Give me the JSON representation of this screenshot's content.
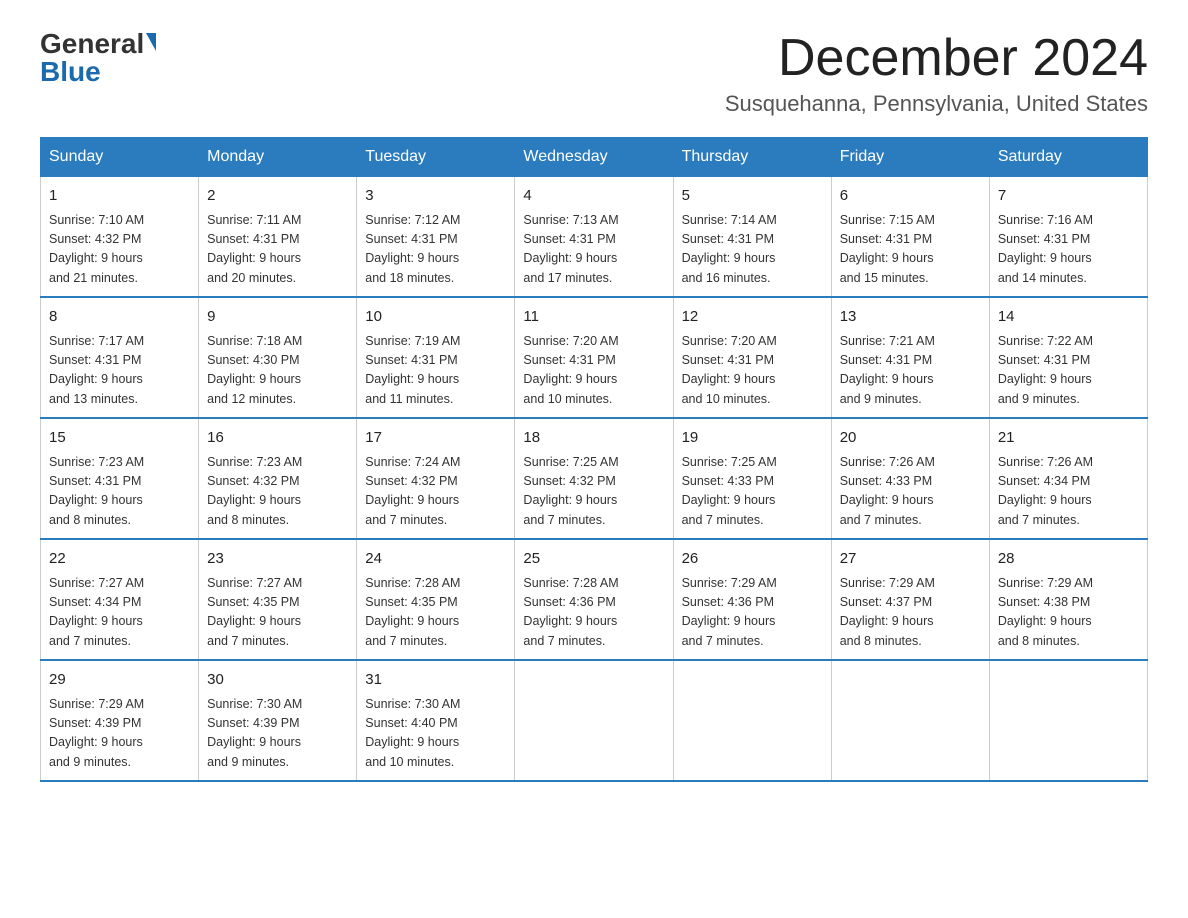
{
  "logo": {
    "general": "General",
    "blue": "Blue"
  },
  "title": {
    "month": "December 2024",
    "location": "Susquehanna, Pennsylvania, United States"
  },
  "weekdays": [
    "Sunday",
    "Monday",
    "Tuesday",
    "Wednesday",
    "Thursday",
    "Friday",
    "Saturday"
  ],
  "weeks": [
    [
      {
        "day": "1",
        "sunrise": "7:10 AM",
        "sunset": "4:32 PM",
        "daylight": "9 hours and 21 minutes."
      },
      {
        "day": "2",
        "sunrise": "7:11 AM",
        "sunset": "4:31 PM",
        "daylight": "9 hours and 20 minutes."
      },
      {
        "day": "3",
        "sunrise": "7:12 AM",
        "sunset": "4:31 PM",
        "daylight": "9 hours and 18 minutes."
      },
      {
        "day": "4",
        "sunrise": "7:13 AM",
        "sunset": "4:31 PM",
        "daylight": "9 hours and 17 minutes."
      },
      {
        "day": "5",
        "sunrise": "7:14 AM",
        "sunset": "4:31 PM",
        "daylight": "9 hours and 16 minutes."
      },
      {
        "day": "6",
        "sunrise": "7:15 AM",
        "sunset": "4:31 PM",
        "daylight": "9 hours and 15 minutes."
      },
      {
        "day": "7",
        "sunrise": "7:16 AM",
        "sunset": "4:31 PM",
        "daylight": "9 hours and 14 minutes."
      }
    ],
    [
      {
        "day": "8",
        "sunrise": "7:17 AM",
        "sunset": "4:31 PM",
        "daylight": "9 hours and 13 minutes."
      },
      {
        "day": "9",
        "sunrise": "7:18 AM",
        "sunset": "4:30 PM",
        "daylight": "9 hours and 12 minutes."
      },
      {
        "day": "10",
        "sunrise": "7:19 AM",
        "sunset": "4:31 PM",
        "daylight": "9 hours and 11 minutes."
      },
      {
        "day": "11",
        "sunrise": "7:20 AM",
        "sunset": "4:31 PM",
        "daylight": "9 hours and 10 minutes."
      },
      {
        "day": "12",
        "sunrise": "7:20 AM",
        "sunset": "4:31 PM",
        "daylight": "9 hours and 10 minutes."
      },
      {
        "day": "13",
        "sunrise": "7:21 AM",
        "sunset": "4:31 PM",
        "daylight": "9 hours and 9 minutes."
      },
      {
        "day": "14",
        "sunrise": "7:22 AM",
        "sunset": "4:31 PM",
        "daylight": "9 hours and 9 minutes."
      }
    ],
    [
      {
        "day": "15",
        "sunrise": "7:23 AM",
        "sunset": "4:31 PM",
        "daylight": "9 hours and 8 minutes."
      },
      {
        "day": "16",
        "sunrise": "7:23 AM",
        "sunset": "4:32 PM",
        "daylight": "9 hours and 8 minutes."
      },
      {
        "day": "17",
        "sunrise": "7:24 AM",
        "sunset": "4:32 PM",
        "daylight": "9 hours and 7 minutes."
      },
      {
        "day": "18",
        "sunrise": "7:25 AM",
        "sunset": "4:32 PM",
        "daylight": "9 hours and 7 minutes."
      },
      {
        "day": "19",
        "sunrise": "7:25 AM",
        "sunset": "4:33 PM",
        "daylight": "9 hours and 7 minutes."
      },
      {
        "day": "20",
        "sunrise": "7:26 AM",
        "sunset": "4:33 PM",
        "daylight": "9 hours and 7 minutes."
      },
      {
        "day": "21",
        "sunrise": "7:26 AM",
        "sunset": "4:34 PM",
        "daylight": "9 hours and 7 minutes."
      }
    ],
    [
      {
        "day": "22",
        "sunrise": "7:27 AM",
        "sunset": "4:34 PM",
        "daylight": "9 hours and 7 minutes."
      },
      {
        "day": "23",
        "sunrise": "7:27 AM",
        "sunset": "4:35 PM",
        "daylight": "9 hours and 7 minutes."
      },
      {
        "day": "24",
        "sunrise": "7:28 AM",
        "sunset": "4:35 PM",
        "daylight": "9 hours and 7 minutes."
      },
      {
        "day": "25",
        "sunrise": "7:28 AM",
        "sunset": "4:36 PM",
        "daylight": "9 hours and 7 minutes."
      },
      {
        "day": "26",
        "sunrise": "7:29 AM",
        "sunset": "4:36 PM",
        "daylight": "9 hours and 7 minutes."
      },
      {
        "day": "27",
        "sunrise": "7:29 AM",
        "sunset": "4:37 PM",
        "daylight": "9 hours and 8 minutes."
      },
      {
        "day": "28",
        "sunrise": "7:29 AM",
        "sunset": "4:38 PM",
        "daylight": "9 hours and 8 minutes."
      }
    ],
    [
      {
        "day": "29",
        "sunrise": "7:29 AM",
        "sunset": "4:39 PM",
        "daylight": "9 hours and 9 minutes."
      },
      {
        "day": "30",
        "sunrise": "7:30 AM",
        "sunset": "4:39 PM",
        "daylight": "9 hours and 9 minutes."
      },
      {
        "day": "31",
        "sunrise": "7:30 AM",
        "sunset": "4:40 PM",
        "daylight": "9 hours and 10 minutes."
      },
      null,
      null,
      null,
      null
    ]
  ],
  "labels": {
    "sunrise": "Sunrise:",
    "sunset": "Sunset:",
    "daylight": "Daylight:"
  }
}
